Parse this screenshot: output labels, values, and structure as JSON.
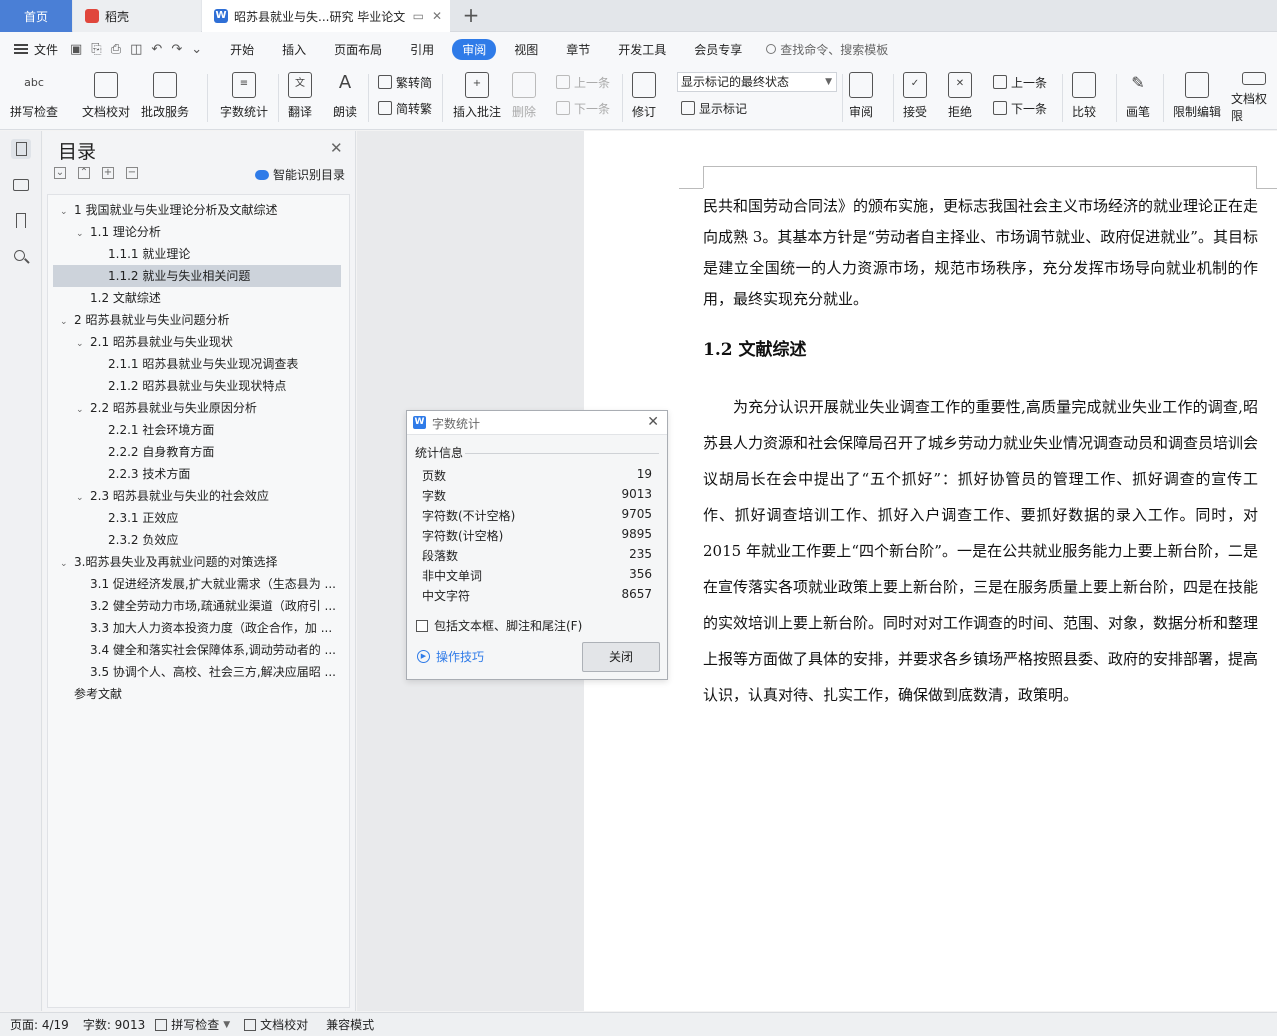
{
  "tabs": {
    "home": "首页",
    "shell": "稻壳",
    "doc": "昭苏县就业与失...研究 毕业论文",
    "add": "+"
  },
  "menu": {
    "file": "文件",
    "tabs": [
      "开始",
      "插入",
      "页面布局",
      "引用",
      "审阅",
      "视图",
      "章节",
      "开发工具",
      "会员专享"
    ],
    "active_tab": "审阅",
    "search_placeholder": "查找命令、搜索模板"
  },
  "ribbon": {
    "spell_check": "拼写检查",
    "doc_proof": "文档校对",
    "batch_service": "批改服务",
    "word_count": "字数统计",
    "translate": "翻译",
    "read_aloud": "朗读",
    "trad_to_simp": "繁转简",
    "simp_to_trad": "简转繁",
    "insert_comment": "插入批注",
    "delete": "删除",
    "prev_comment": "上一条",
    "next_comment": "下一条",
    "track_changes": "修订",
    "markup_select": "显示标记的最终状态",
    "show_markup": "显示标记",
    "review": "审阅",
    "accept": "接受",
    "reject": "拒绝",
    "prev_change": "上一条",
    "next_change": "下一条",
    "compare": "比较",
    "pen": "画笔",
    "restrict_edit": "限制编辑",
    "doc_permission": "文档权限"
  },
  "outline": {
    "title": "目录",
    "smart_toc": "智能识别目录",
    "items": [
      {
        "label": "1 我国就业与失业理论分析及文献综述",
        "level": 0,
        "expanded": true
      },
      {
        "label": "1.1 理论分析",
        "level": 1,
        "expanded": true
      },
      {
        "label": "1.1.1 就业理论",
        "level": 2
      },
      {
        "label": "1.1.2 就业与失业相关问题",
        "level": 2,
        "selected": true
      },
      {
        "label": "1.2 文献综述",
        "level": 1
      },
      {
        "label": "2  昭苏县就业与失业问题分析",
        "level": 0,
        "expanded": true
      },
      {
        "label": "2.1 昭苏县就业与失业现状",
        "level": 1,
        "expanded": true
      },
      {
        "label": "2.1.1 昭苏县就业与失业现况调查表",
        "level": 2
      },
      {
        "label": "2.1.2 昭苏县就业与失业现状特点",
        "level": 2
      },
      {
        "label": "2.2  昭苏县就业与失业原因分析",
        "level": 1,
        "expanded": true
      },
      {
        "label": "2.2.1 社会环境方面",
        "level": 2
      },
      {
        "label": "2.2.2 自身教育方面",
        "level": 2
      },
      {
        "label": "2.2.3 技术方面",
        "level": 2
      },
      {
        "label": "2.3  昭苏县就业与失业的社会效应",
        "level": 1,
        "expanded": true
      },
      {
        "label": "2.3.1 正效应",
        "level": 2
      },
      {
        "label": "2.3.2 负效应",
        "level": 2
      },
      {
        "label": "3.昭苏县失业及再就业问题的对策选择",
        "level": 0,
        "expanded": true
      },
      {
        "label": "3.1 促进经济发展,扩大就业需求（生态县为 ...",
        "level": 1
      },
      {
        "label": "3.2 健全劳动力市场,疏通就业渠道（政府引 ...",
        "level": 1
      },
      {
        "label": "3.3  加大人力资本投资力度（政企合作，加 ...",
        "level": 1
      },
      {
        "label": "3.4 健全和落实社会保障体系,调动劳动者的 ...",
        "level": 1
      },
      {
        "label": "3.5  协调个人、高校、社会三方,解决应届昭 ...",
        "level": 1
      },
      {
        "label": "参考文献",
        "level": 0
      }
    ]
  },
  "document": {
    "para1": "民共和国劳动合同法》的颁布实施，更标志我国社会主义市场经济的就业理论正在走向成熟 3。其基本方针是“劳动者自主择业、市场调节就业、政府促进就业”。其目标是建立全国统一的人力资源市场，规范市场秩序，充分发挥市场导向就业机制的作用，最终实现充分就业。",
    "heading": "1.2 文献综述",
    "para2": "为充分认识开展就业失业调查工作的重要性,高质量完成就业失业工作的调查,昭苏县人力资源和社会保障局召开了城乡劳动力就业失业情况调查动员和调查员培训会议胡局长在会中提出了“五个抓好”：抓好协管员的管理工作、抓好调查的宣传工作、抓好调查培训工作、抓好入户调查工作、要抓好数据的录入工作。同时，对 2015 年就业工作要上“四个新台阶”。一是在公共就业服务能力上要上新台阶，二是在宣传落实各项就业政策上要上新台阶，三是在服务质量上要上新台阶，四是在技能的实效培训上要上新台阶。同时对对工作调查的时间、范围、对象，数据分析和整理上报等方面做了具体的安排，并要求各乡镇场严格按照县委、政府的安排部署，提高认识，认真对待、扎实工作，确保做到底数清，政策明。"
  },
  "word_count_dialog": {
    "title": "字数统计",
    "section": "统计信息",
    "rows": [
      {
        "label": "页数",
        "value": "19"
      },
      {
        "label": "字数",
        "value": "9013"
      },
      {
        "label": "字符数(不计空格)",
        "value": "9705"
      },
      {
        "label": "字符数(计空格)",
        "value": "9895"
      },
      {
        "label": "段落数",
        "value": "235"
      },
      {
        "label": "非中文单词",
        "value": "356"
      },
      {
        "label": "中文字符",
        "value": "8657"
      }
    ],
    "checkbox_label": "包括文本框、脚注和尾注(F)",
    "tips": "操作技巧",
    "close_button": "关闭"
  },
  "status": {
    "page": "页面: 4/19",
    "words": "字数: 9013",
    "spell": "拼写检查",
    "proof": "文档校对",
    "compat": "兼容模式"
  },
  "colors": {
    "accent": "#2f7be8",
    "home_tab": "#4a7fd6"
  }
}
